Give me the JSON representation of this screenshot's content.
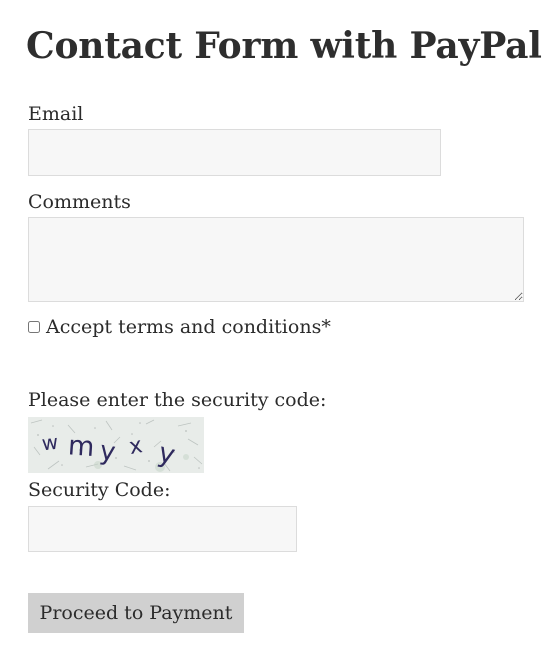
{
  "form": {
    "title": "Contact Form with PayPal",
    "email_label": "Email",
    "email_value": "",
    "comments_label": "Comments",
    "comments_value": "",
    "terms_label": "Accept terms and conditions*",
    "terms_checked": false,
    "security_prompt": "Please enter the security code:",
    "captcha_text": "wmyxy",
    "security_code_label": "Security Code:",
    "security_code_value": "",
    "submit_label": "Proceed to Payment"
  },
  "colors": {
    "field_background": "#f7f7f7",
    "field_border": "#dcdcdc",
    "button_background": "#d0d0d0",
    "captcha_ink": "#2f2a5e"
  }
}
